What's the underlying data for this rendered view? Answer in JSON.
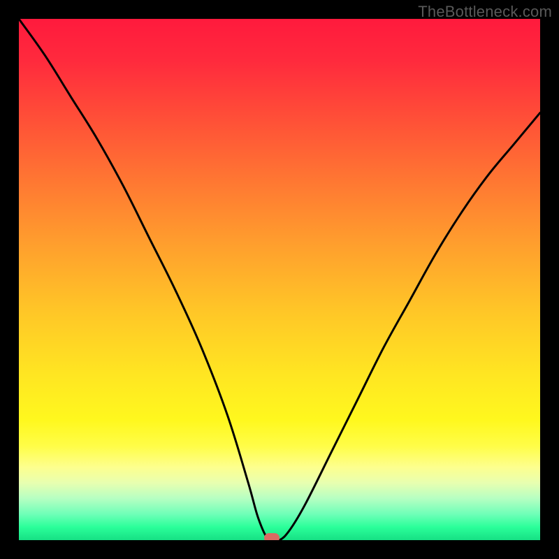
{
  "watermark": "TheBottleneck.com",
  "chart_data": {
    "type": "line",
    "title": "",
    "xlabel": "",
    "ylabel": "",
    "xlim": [
      0,
      100
    ],
    "ylim": [
      0,
      100
    ],
    "grid": false,
    "legend": false,
    "description": "Bottleneck percentage curve over a red-to-green heat gradient. The black curve descends steeply from the top-left, reaches a minimum near x≈48 (bottleneck ≈0%), then rises toward the right edge. A small rounded marker sits at the minimum.",
    "series": [
      {
        "name": "bottleneck-curve",
        "x": [
          0,
          5,
          10,
          15,
          20,
          25,
          30,
          35,
          40,
          44,
          46,
          48,
          50,
          52,
          55,
          60,
          65,
          70,
          75,
          80,
          85,
          90,
          95,
          100
        ],
        "y": [
          100,
          93,
          85,
          77,
          68,
          58,
          48,
          37,
          24,
          11,
          4,
          0,
          0,
          2,
          7,
          17,
          27,
          37,
          46,
          55,
          63,
          70,
          76,
          82
        ]
      }
    ],
    "marker": {
      "x": 48.5,
      "y": 0
    },
    "gradient_stops": [
      {
        "pct": 0,
        "color": "#ff1a3d"
      },
      {
        "pct": 50,
        "color": "#ffcc22"
      },
      {
        "pct": 80,
        "color": "#ffff40"
      },
      {
        "pct": 100,
        "color": "#16e084"
      }
    ]
  }
}
